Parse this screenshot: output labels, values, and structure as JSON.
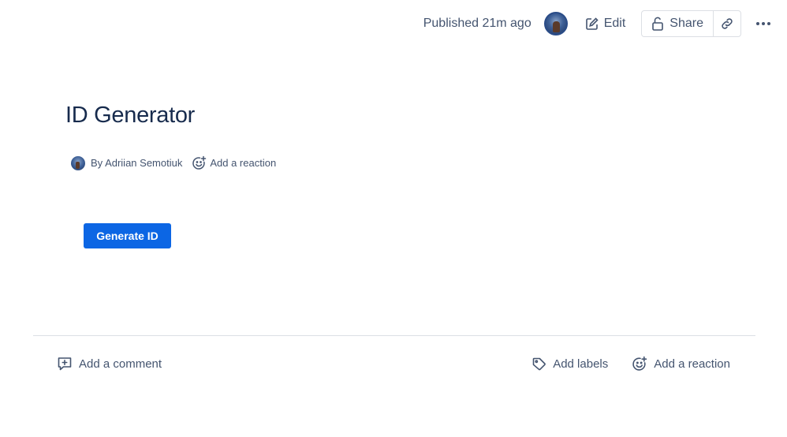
{
  "header": {
    "published": "Published 21m ago",
    "edit_label": "Edit",
    "share_label": "Share"
  },
  "page": {
    "title": "ID Generator",
    "byline": "By Adriian Semotiuk",
    "reaction_label": "Add a reaction",
    "generate_button": "Generate ID"
  },
  "footer": {
    "comment_label": "Add a comment",
    "labels_label": "Add labels",
    "reaction_label": "Add a reaction"
  },
  "colors": {
    "accent": "#0c66e4",
    "text": "#172b4d",
    "subtle": "#44546f",
    "border": "#dcdfe4"
  },
  "icons": [
    "edit-icon",
    "lock-icon",
    "link-icon",
    "more-icon",
    "emoji-add-icon",
    "comment-add-icon",
    "tag-icon"
  ]
}
